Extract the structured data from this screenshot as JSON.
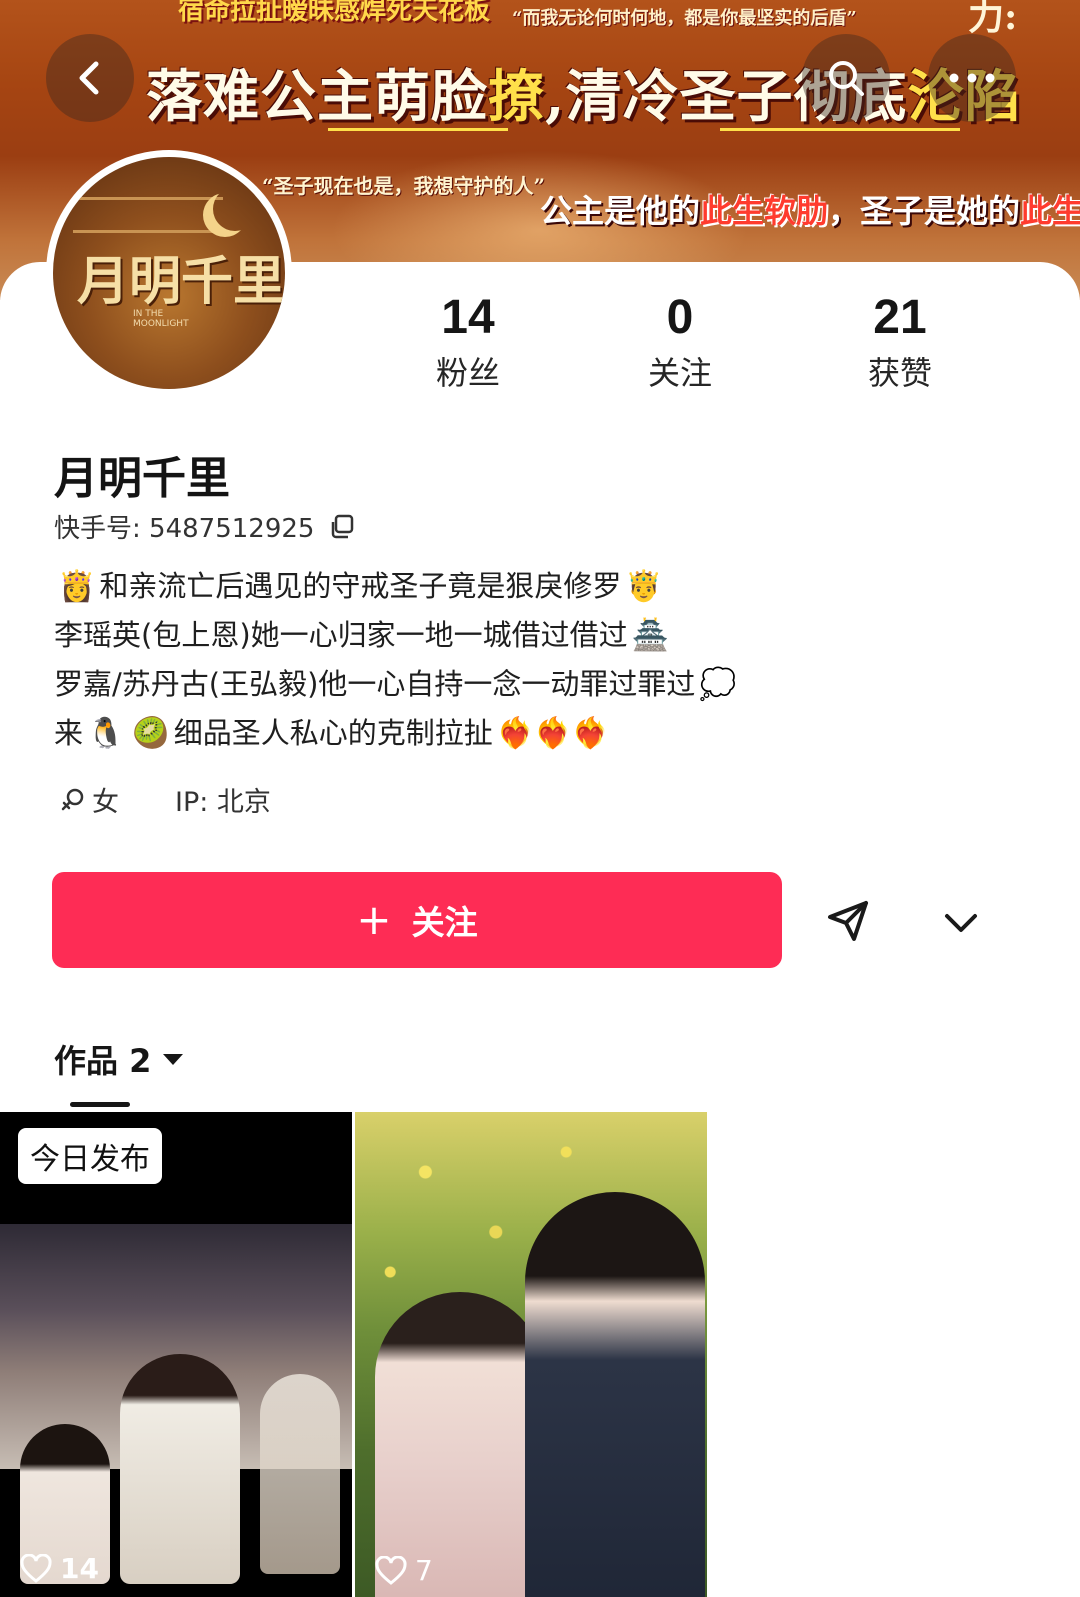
{
  "banner": {
    "top_left": "宿命拉扯暧昧感焊死天花板",
    "top_right": "“而我无论何时何地，都是你最坚实的后盾”",
    "corner": "力:",
    "main_a": "落难公主萌脸",
    "main_hl1": "撩",
    "main_b": ",清冷圣子彻底",
    "main_hl2": "沦陷",
    "quote_left": "“圣子现在也是，我想守护的人”",
    "quote_right_a": "公主是他的",
    "quote_right_hl1": "此生软肋",
    "quote_right_b": "，圣子是她的",
    "quote_right_hl2": "此生唯一"
  },
  "avatar": {
    "title": "月明千里",
    "subtitle_line1": "IN THE",
    "subtitle_line2": "MOONLIGHT"
  },
  "stats": {
    "fans_count": "14",
    "fans_label": "粉丝",
    "following_count": "0",
    "following_label": "关注",
    "likes_count": "21",
    "likes_label": "获赞"
  },
  "profile": {
    "name": "月明千里",
    "account_id": "快手号: 5487512925",
    "bio": {
      "line1_emoji_start": "👸",
      "line1": "和亲流亡后遇见的守戒圣子竟是狠戾修罗",
      "line1_emoji_end": "🤴",
      "line2": "李瑶英(包上恩)她一心归家一地一城借过借过",
      "line2_emoji": "🏯",
      "line3": "罗嘉/苏丹古(王弘毅)他一心自持一念一动罪过罪过",
      "line3_emoji": "💭",
      "line4_prefix": "来",
      "line4_emoji1": "🐧",
      "line4_emoji2": "🥝",
      "line4": "细品圣人私心的克制拉扯",
      "line4_emoji_end": "❤️‍🔥❤️‍🔥❤️‍🔥"
    },
    "gender": "女",
    "ip": "IP: 北京"
  },
  "actions": {
    "follow_plus": "+",
    "follow_label": "关注"
  },
  "tabs": {
    "works_label": "作品 2"
  },
  "works": [
    {
      "badge": "今日发布",
      "likes": "14"
    },
    {
      "badge": "",
      "likes": "7"
    }
  ],
  "colors": {
    "follow_button": "#fe2c55",
    "banner_highlight": "#ffe04a"
  },
  "icons": {
    "back": "chevron-left-icon",
    "search": "search-icon",
    "more": "more-horizontal-icon",
    "copy": "copy-icon",
    "gender": "female-icon",
    "share": "share-icon",
    "expand": "chevron-down-icon",
    "dropdown": "triangle-down-icon",
    "like": "heart-icon"
  }
}
